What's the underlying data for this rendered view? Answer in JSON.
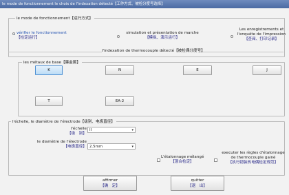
{
  "window": {
    "title": "le mode de fonctionnement  le choix de l'indexation détecté【工作方式、被检分度号选择】"
  },
  "mode_group": {
    "legend": "le mode de fonctionnement【运行方式】",
    "options": [
      {
        "label": "vérifier le fonctionnement",
        "sub": "【检定运行】",
        "selected": true
      },
      {
        "label": "simulation et présentation de marche",
        "sub": "【模拟、演示运行】",
        "selected": false
      },
      {
        "label": "Les enregistrements et l'enquête de l'impression",
        "line1": "Les enregistrements et",
        "line2": "l'enquête de l'impression",
        "sub": "【查阅、打印记录】",
        "selected": false
      }
    ]
  },
  "thermocouple_group": {
    "legend": "l'indexation de thermocouple détecté【被检偶分度号】",
    "metals_label": "les métaux de base【廉金属】",
    "buttons": [
      "K",
      "N",
      "E",
      "J",
      "T",
      "EA-2"
    ],
    "selected": "K"
  },
  "scale_group": {
    "legend": "l'échelle, le diamètre de l'électrode【级别、电极直径】",
    "echelle_label": "l'échelle",
    "echelle_sub": "【级　别】",
    "echelle_value": "II",
    "diameter_label": "le diamètre de l'électrode",
    "diameter_sub": "【电极直径】",
    "diameter_value": "2.5mm",
    "mixed_label": "L'étalonnage mélangé",
    "mixed_sub": "【混合检定】",
    "rules_line1": "executer les règles d'étalonnage",
    "rules_line2": "de thermocouple gainé",
    "rules_sub": "【执行铠装热电偶检定规范】"
  },
  "actions": {
    "confirm_label": "affirmer",
    "confirm_sub": "【确　定】",
    "quit_label": "quitter",
    "quit_sub": "【退　出】"
  },
  "colors": {
    "accent": "#1f6fc5",
    "selected_button": "#bcdcf6",
    "window_bg": "#f2f2f2",
    "titlebar": "#4a6aa3"
  }
}
